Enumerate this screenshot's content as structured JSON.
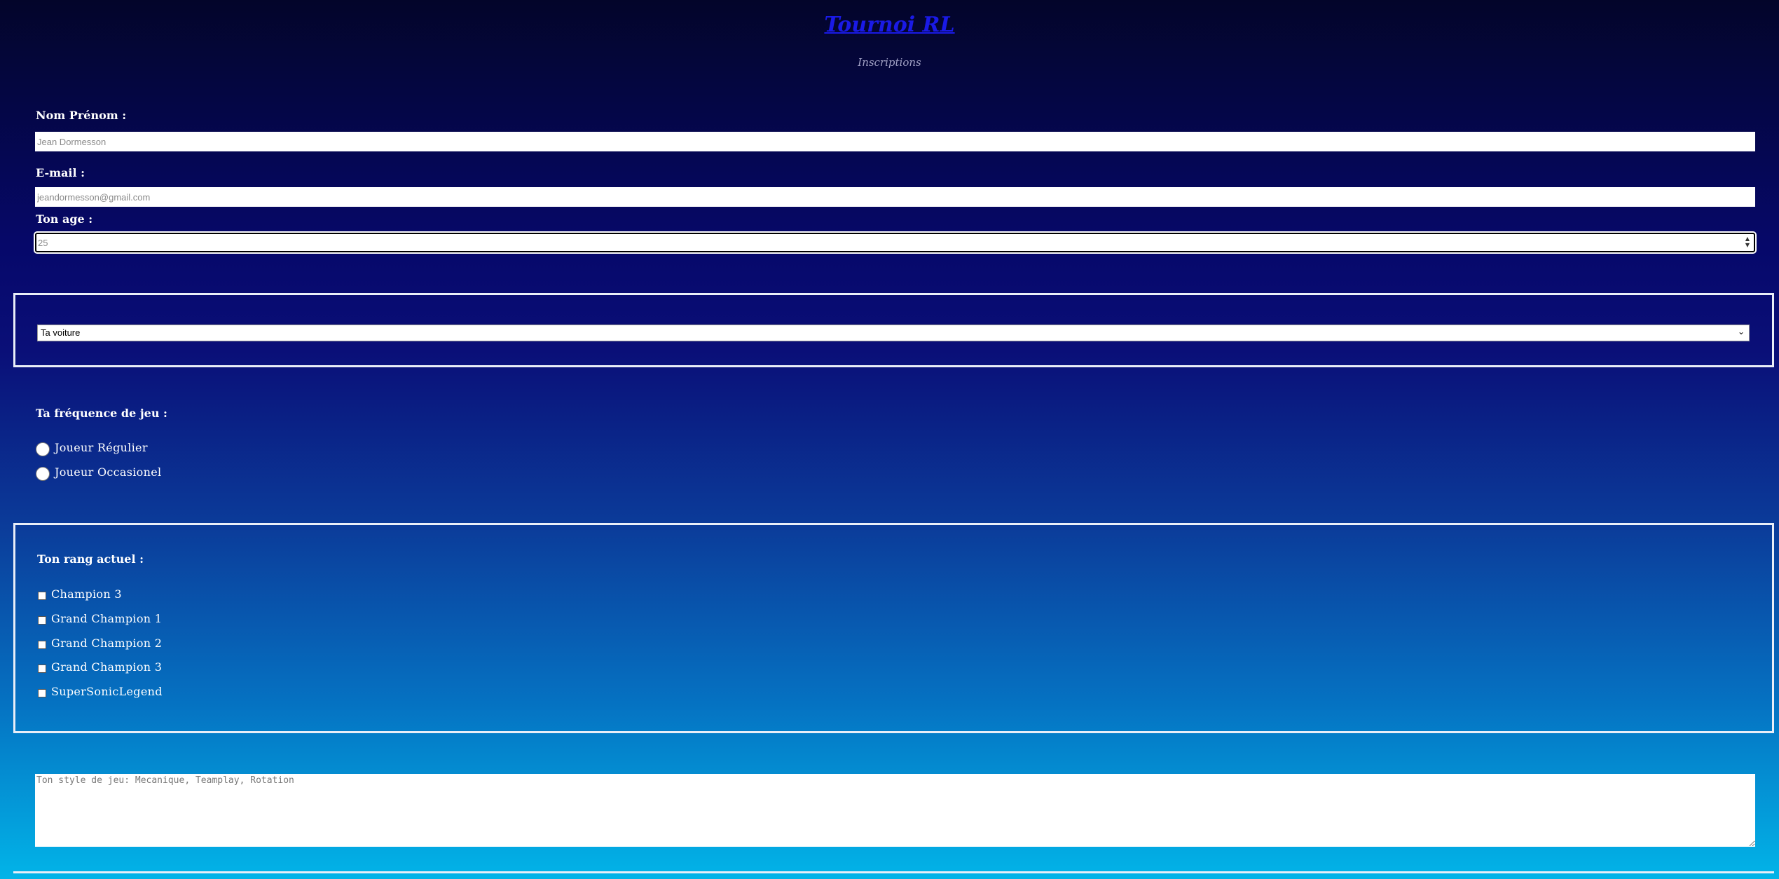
{
  "header": {
    "title": "Tournoi RL",
    "subtitle": "Inscriptions"
  },
  "form": {
    "name": {
      "label": "Nom Prénom :",
      "placeholder": "Jean Dormesson",
      "value": ""
    },
    "email": {
      "label": "E-mail :",
      "placeholder": "jeandormesson@gmail.com",
      "value": ""
    },
    "age": {
      "label": "Ton age :",
      "placeholder": "25",
      "value": ""
    },
    "car_select": {
      "selected": "Ta voiture"
    },
    "frequency": {
      "label": "Ta fréquence de jeu :",
      "options": [
        "Joueur Régulier",
        "Joueur Occasionel"
      ]
    },
    "rank": {
      "label": "Ton rang actuel :",
      "options": [
        "Champion 3",
        "Grand Champion 1",
        "Grand Champion 2",
        "Grand Champion 3",
        "SuperSonicLegend"
      ]
    },
    "style": {
      "placeholder": "Ton style de jeu: Mecanique, Teamplay, Rotation"
    }
  },
  "icons": {
    "spinner": "number-spinner-icon",
    "dropdown": "chevron-down-icon"
  },
  "colors": {
    "title": "#1a1ae6",
    "border": "#e9eef8",
    "bg_top": "#03052a",
    "bg_bottom": "#02b4e8"
  }
}
